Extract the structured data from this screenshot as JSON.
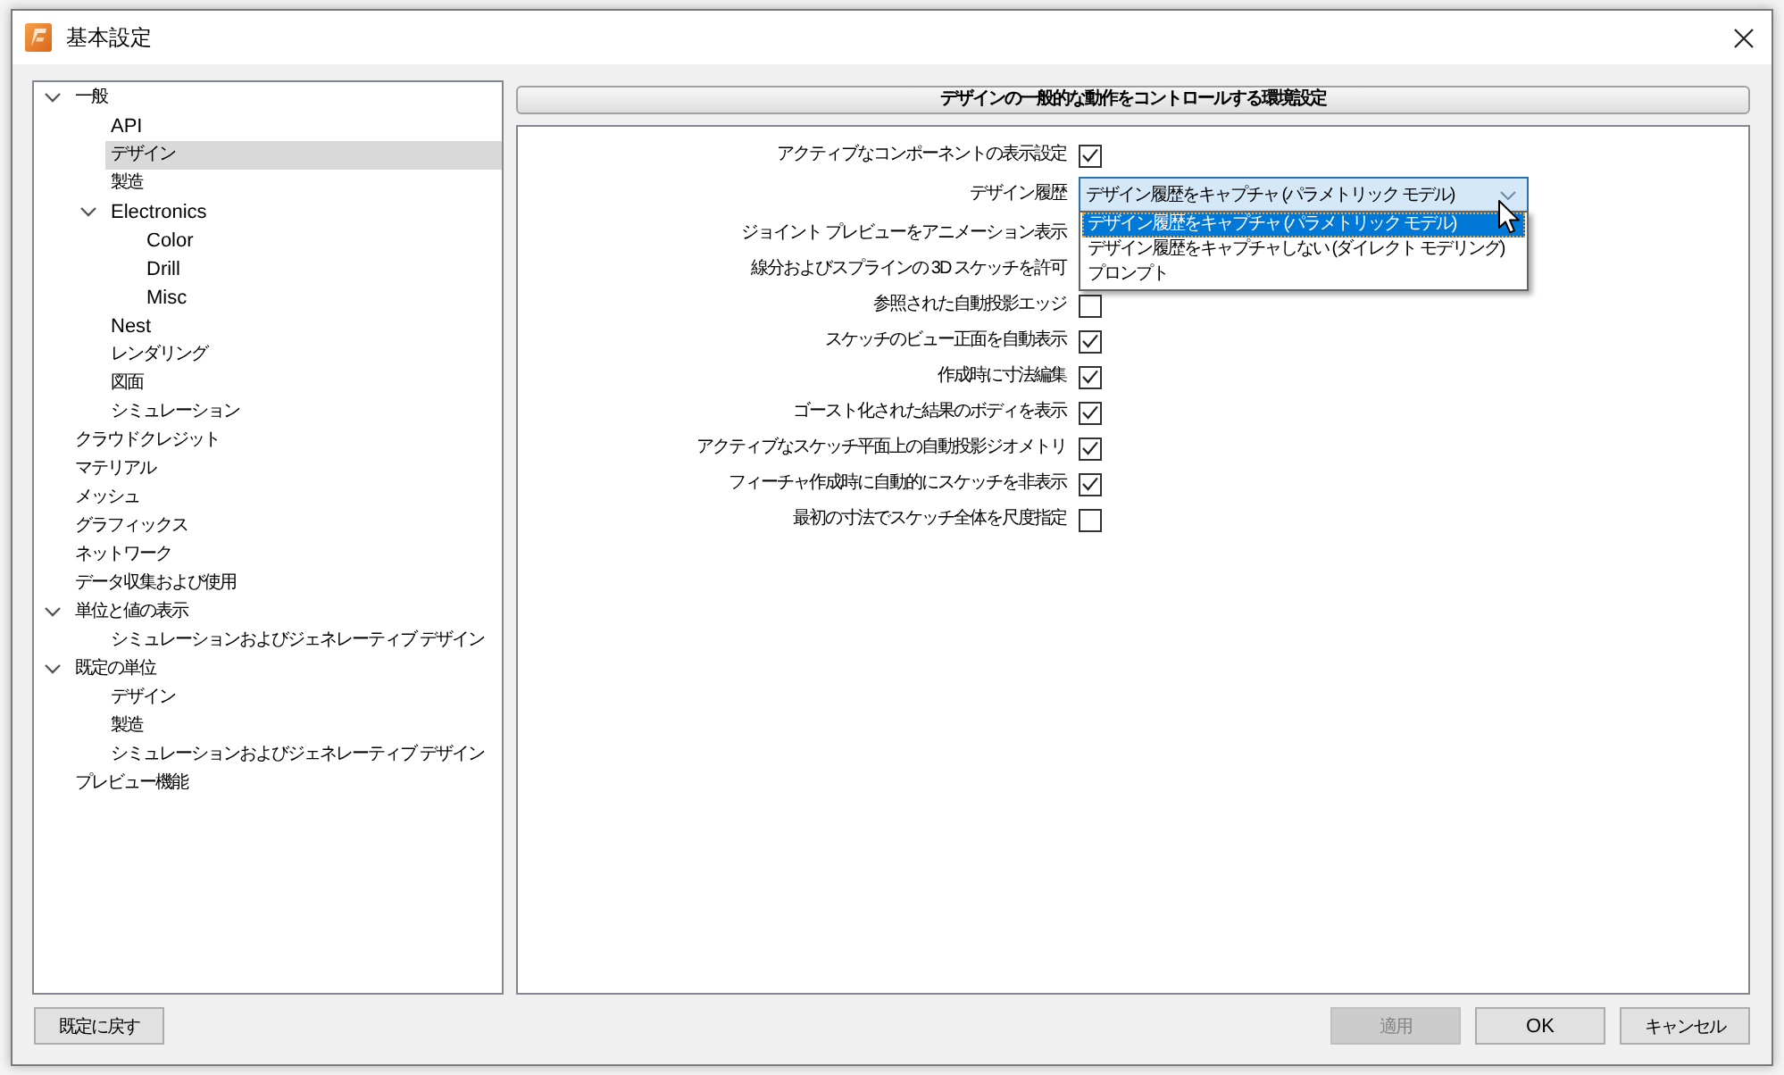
{
  "window": {
    "title": "基本設定"
  },
  "tree": [
    {
      "label": "一般",
      "expanded": true,
      "selected": false,
      "children": [
        {
          "label": "API",
          "selected": false
        },
        {
          "label": "デザイン",
          "selected": true
        },
        {
          "label": "製造",
          "selected": false
        },
        {
          "label": "Electronics",
          "expanded": true,
          "selected": false,
          "children": [
            {
              "label": "Color",
              "selected": false
            },
            {
              "label": "Drill",
              "selected": false
            },
            {
              "label": "Misc",
              "selected": false
            }
          ]
        },
        {
          "label": "Nest",
          "selected": false
        },
        {
          "label": "レンダリング",
          "selected": false
        },
        {
          "label": "図面",
          "selected": false
        },
        {
          "label": "シミュレーション",
          "selected": false
        }
      ]
    },
    {
      "label": "クラウドクレジット",
      "selected": false
    },
    {
      "label": "マテリアル",
      "selected": false
    },
    {
      "label": "メッシュ",
      "selected": false
    },
    {
      "label": "グラフィックス",
      "selected": false
    },
    {
      "label": "ネットワーク",
      "selected": false
    },
    {
      "label": "データ収集および使用",
      "selected": false
    },
    {
      "label": "単位と値の表示",
      "expanded": true,
      "selected": false,
      "children": [
        {
          "label": "シミュレーションおよびジェネレーティブ デザイン",
          "selected": false
        }
      ]
    },
    {
      "label": "既定の単位",
      "expanded": true,
      "selected": false,
      "children": [
        {
          "label": "デザイン",
          "selected": false
        },
        {
          "label": "製造",
          "selected": false
        },
        {
          "label": "シミュレーションおよびジェネレーティブ デザイン",
          "selected": false
        }
      ]
    },
    {
      "label": "プレビュー機能",
      "selected": false
    }
  ],
  "panel": {
    "title": "デザインの一般的な動作をコントロールする環境設定",
    "settings": [
      {
        "kind": "checkbox",
        "label": "アクティブなコンポーネントの表示設定",
        "checked": true
      },
      {
        "kind": "dropdown",
        "label": "デザイン履歴",
        "value": "デザイン履歴をキャプチャ (パラメトリック モデル)",
        "expanded": true,
        "options": [
          {
            "label": "デザイン履歴をキャプチャ (パラメトリック モデル)",
            "selected": true
          },
          {
            "label": "デザイン履歴をキャプチャしない (ダイレクト モデリング)",
            "selected": false
          },
          {
            "label": "プロンプト",
            "selected": false
          }
        ]
      },
      {
        "kind": "checkbox",
        "label": "ジョイント プレビューをアニメーション表示"
      },
      {
        "kind": "checkbox",
        "label": "線分およびスプラインの 3D スケッチを許可"
      },
      {
        "kind": "checkbox",
        "label": "参照された自動投影エッジ",
        "checked": false
      },
      {
        "kind": "checkbox",
        "label": "スケッチのビュー正面を自動表示",
        "checked": true
      },
      {
        "kind": "checkbox",
        "label": "作成時に寸法編集",
        "checked": true
      },
      {
        "kind": "checkbox",
        "label": "ゴースト化された結果のボディを表示",
        "checked": true
      },
      {
        "kind": "checkbox",
        "label": "アクティブなスケッチ平面上の自動投影ジオメトリ",
        "checked": true
      },
      {
        "kind": "checkbox",
        "label": "フィーチャ作成時に自動的にスケッチを非表示",
        "checked": true
      },
      {
        "kind": "checkbox",
        "label": "最初の寸法でスケッチ全体を尺度指定",
        "checked": false
      }
    ]
  },
  "footer": {
    "reset_button": {
      "label": "既定に戻す"
    },
    "actions": [
      {
        "label": "適用",
        "disabled": true
      },
      {
        "label": "OK",
        "disabled": false
      },
      {
        "label": "キャンセル",
        "disabled": false
      }
    ]
  }
}
